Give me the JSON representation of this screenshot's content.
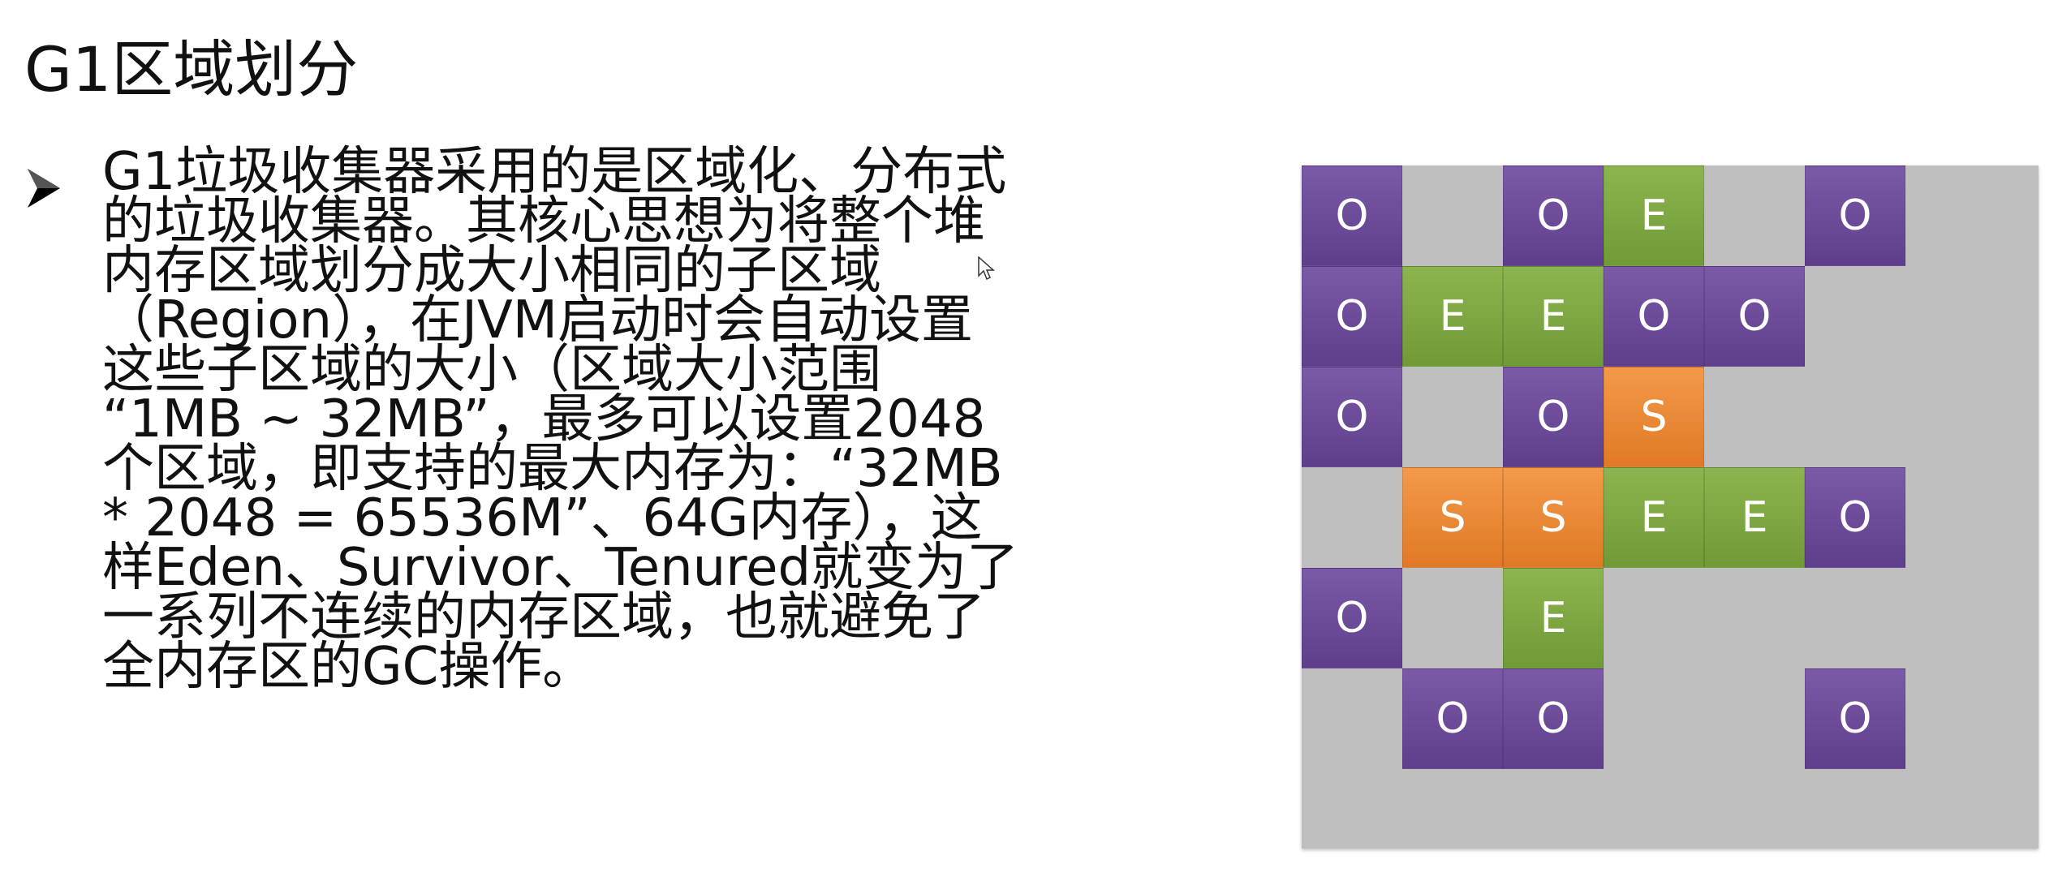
{
  "slide": {
    "title": "G1区域划分",
    "bullet_lines": [
      "G1垃圾收集器采用的是区域化、分布式",
      "的垃圾收集器。其核心思想为将整个堆",
      "内存区域划分成大小相同的子区域",
      "（Region），在JVM启动时会自动设置",
      "这些子区域的大小（区域大小范围",
      "“1MB ~ 32MB”，最多可以设置2048",
      "个区域，即支持的最大内存为：“32MB",
      "* 2048 = 65536M”、64G内存），这",
      "样Eden、Survivor、Tenured就变为了",
      "一系列不连续的内存区域，也就避免了",
      "全内存区的GC操作。"
    ]
  },
  "diagram": {
    "colors": {
      "O": "#6b4c9a",
      "E": "#7fa844",
      "S": "#ee8a33",
      "background": "#bfbfbf"
    },
    "rows": [
      [
        "O",
        "",
        "O",
        "E",
        "",
        "O",
        "",
        ""
      ],
      [
        "O",
        "E",
        "E",
        "O",
        "O",
        "",
        "",
        ""
      ],
      [
        "O",
        "",
        "O",
        "S",
        "",
        "",
        "",
        ""
      ],
      [
        "",
        "S",
        "S",
        "E",
        "E",
        "O",
        "",
        ""
      ],
      [
        "O",
        "",
        "E",
        "",
        "",
        "",
        "",
        ""
      ],
      [
        "",
        "O",
        "O",
        "",
        "",
        "O",
        "",
        ""
      ]
    ]
  }
}
